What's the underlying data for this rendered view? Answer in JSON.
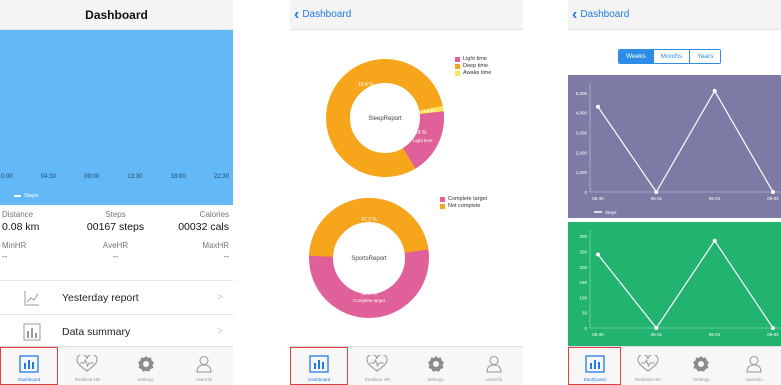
{
  "screen1": {
    "title": "Dashboard",
    "time_axis": [
      "0:00",
      "04:30",
      "09:00",
      "13:30",
      "18:00",
      "22:30"
    ],
    "legend": "Steps",
    "stats": {
      "distance_label": "Distance",
      "distance_value": "0.08 km",
      "steps_label": "Steps",
      "steps_value": "00167 steps",
      "calories_label": "Calories",
      "calories_value": "00032 cals",
      "minhr_label": "MinHR",
      "minhr_value": "--",
      "avehr_label": "AveHR",
      "avehr_value": "--",
      "maxhr_label": "MaxHR",
      "maxhr_value": "--"
    },
    "menu": [
      {
        "label": "Yesterday report",
        "icon": "line-chart-icon"
      },
      {
        "label": "Data summary",
        "icon": "bar-chart-icon"
      }
    ],
    "colors": {
      "chart_bg": "#63b8f7"
    }
  },
  "screen2": {
    "back_label": "Dashboard",
    "sleep": {
      "center": "SleepReport",
      "pct_large": "18.4 %",
      "pct_large_sub": "",
      "pct_small": "18 %",
      "pct_small_sub": "Light time",
      "pct_tiny": "1.4 %",
      "legend": [
        {
          "label": "Light time",
          "color": "#e0609a"
        },
        {
          "label": "Deep time",
          "color": "#f7a51b"
        },
        {
          "label": "Awake time",
          "color": "#f9e45b"
        }
      ]
    },
    "sports": {
      "center": "SportsReport",
      "pct_top": "47.2 %",
      "pct_top_sub": "Not complete",
      "pct_bottom": "52.8 %",
      "pct_bottom_sub": "Complete target",
      "legend": [
        {
          "label": "Complete target",
          "color": "#e0609a"
        },
        {
          "label": "Not complete",
          "color": "#f7a51b"
        }
      ]
    }
  },
  "screen3": {
    "back_label": "Dashboard",
    "segments": [
      {
        "label": "Weeks",
        "active": true
      },
      {
        "label": "Months",
        "active": false
      },
      {
        "label": "Years",
        "active": false
      }
    ],
    "chart_data": [
      {
        "type": "line",
        "x": [
          "05-30",
          "05-31",
          "06-01",
          "06-02"
        ],
        "series": [
          {
            "name": "Steps",
            "values": [
              4300,
              0,
              5100,
              0
            ]
          }
        ],
        "ylim": [
          0,
          5500
        ],
        "y_ticks": [
          "0",
          "1,000",
          "2,000",
          "3,000",
          "4,000",
          "5,000"
        ],
        "bg": "#7d7ba6"
      },
      {
        "type": "line",
        "x": [
          "05-30",
          "05-31",
          "06-01",
          "06-02"
        ],
        "series": [
          {
            "values": [
              240,
              0,
              285,
              0
            ]
          }
        ],
        "ylim": [
          0,
          320
        ],
        "y_ticks": [
          "0",
          "50",
          "100",
          "150",
          "200",
          "250",
          "300"
        ],
        "bg": "#22b36f"
      }
    ]
  },
  "tabs": [
    {
      "label": "Dashboard",
      "icon": "dashboard-bar-icon"
    },
    {
      "label": "Realtime HR",
      "icon": "heart-pulse-icon"
    },
    {
      "label": "Settings",
      "icon": "gear-icon"
    },
    {
      "label": "UserInfo",
      "icon": "user-icon"
    }
  ]
}
